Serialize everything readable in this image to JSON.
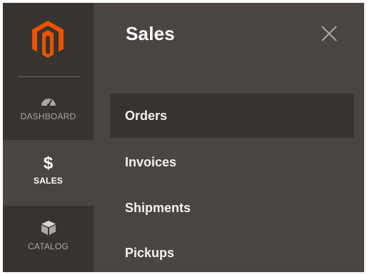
{
  "sidebar": {
    "logo_icon": "magento-logo-icon",
    "items": [
      {
        "label": "DASHBOARD",
        "icon": "speedometer-icon"
      },
      {
        "label": "SALES",
        "icon": "dollar-icon",
        "glyph": "$"
      },
      {
        "label": "CATALOG",
        "icon": "box-icon"
      }
    ]
  },
  "panel": {
    "title": "Sales",
    "close_icon": "close-icon",
    "items": [
      {
        "label": "Orders"
      },
      {
        "label": "Invoices"
      },
      {
        "label": "Shipments"
      },
      {
        "label": "Pickups"
      }
    ]
  },
  "colors": {
    "brand_orange": "#eb5202",
    "sidebar_bg": "#373330",
    "panel_bg": "#4a4542",
    "text_light": "#ffffff",
    "text_muted": "#aaa6a0"
  }
}
